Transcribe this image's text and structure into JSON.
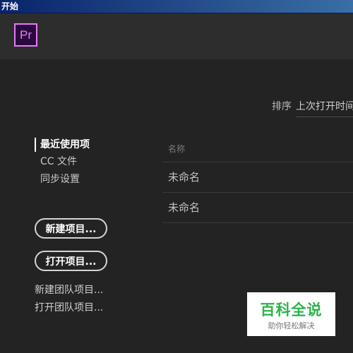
{
  "window": {
    "title": "开始"
  },
  "header": {
    "logo_text": "Pr"
  },
  "sort": {
    "label": "排序",
    "value": "上次打开时间"
  },
  "nav": {
    "items": [
      {
        "label": "最近使用项"
      },
      {
        "label": "CC 文件"
      },
      {
        "label": "同步设置"
      }
    ]
  },
  "actions": {
    "new_project": "新建项目...",
    "open_project": "打开项目...",
    "new_team_project": "新建团队项目...",
    "open_team_project": "打开团队项目..."
  },
  "table": {
    "header_name": "名称",
    "rows": [
      {
        "name": "未命名"
      },
      {
        "name": "未命名"
      }
    ]
  },
  "watermark": {
    "title": "百科全说",
    "subtitle": "助你轻松解决"
  },
  "colors": {
    "background": "#232323",
    "header": "#2d2d2d",
    "premiere_accent": "#e879f9",
    "watermark_green": "#2db34a"
  }
}
